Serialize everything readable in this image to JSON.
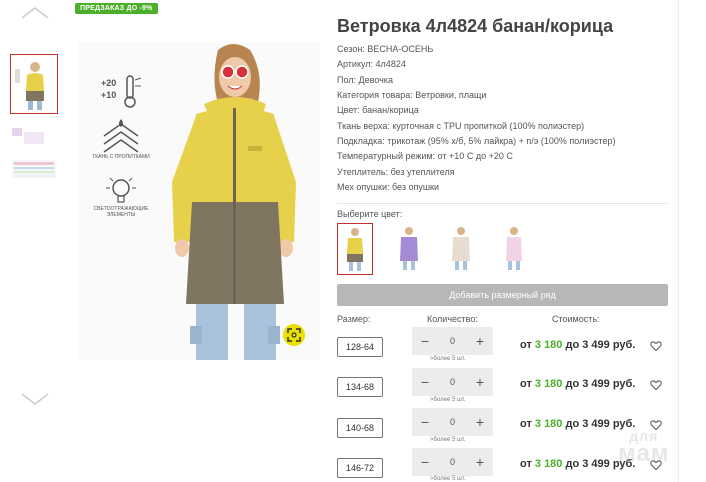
{
  "badge": "ПРЕДЗАКАЗ ДО -9%",
  "product": {
    "title": "Ветровка 4л4824 банан/корица",
    "specs": [
      "Сезон: ВЕСНА-ОСЕНЬ",
      "Артикул: 4л4824",
      "Пол: Девочка",
      "Категория товара: Ветровки, плащи",
      "Цвет: банан/корица",
      "Ткань верха: курточная с TPU пропиткой (100% полиэстер)",
      "Подкладка: трикотаж (95% х/б, 5% лайкра) + п/э (100% полиэстер)",
      "Температурный режим: от +10 С до +20 С",
      "Утеплитель: без утеплителя",
      "Мех опушки: без опушки"
    ]
  },
  "features": {
    "temp_top": "+20",
    "temp_bottom": "+10",
    "fabric_label": "ТКАНЬ С ПРОПИТКАМИ",
    "reflect_label": "СВЕТООТРАЖАЮЩИЕ ЭЛЕМЕНТЫ"
  },
  "color_select": {
    "label": "Выберите цвет:",
    "swatches": [
      "банан/корица",
      "лаванда",
      "бежевый",
      "розовый"
    ]
  },
  "add_size_row_label": "Добавить размерный ряд",
  "table": {
    "col_size": "Размер:",
    "col_qty": "Количество:",
    "col_price": "Стоимость:",
    "rows": [
      {
        "size": "128-64",
        "qty": "0",
        "avail": ">более 5 шт.",
        "price_from": "от ",
        "price_low": "3 180",
        "price_to": " до 3 499 руб."
      },
      {
        "size": "134-68",
        "qty": "0",
        "avail": ">более 5 шт.",
        "price_from": "от ",
        "price_low": "3 180",
        "price_to": " до 3 499 руб."
      },
      {
        "size": "140-68",
        "qty": "0",
        "avail": ">более 5 шт.",
        "price_from": "от ",
        "price_low": "3 180",
        "price_to": " до 3 499 руб."
      },
      {
        "size": "146-72",
        "qty": "0",
        "avail": ">более 5 шт.",
        "price_from": "от ",
        "price_low": "3 180",
        "price_to": " до 3 499 руб."
      }
    ]
  },
  "watermark": {
    "line1": "для",
    "line2": "мам"
  },
  "colors": {
    "accent_green": "#4caf29",
    "active_border": "#c6302f",
    "jacket_yellow": "#e8d14a",
    "jacket_brown": "#7f7561"
  }
}
